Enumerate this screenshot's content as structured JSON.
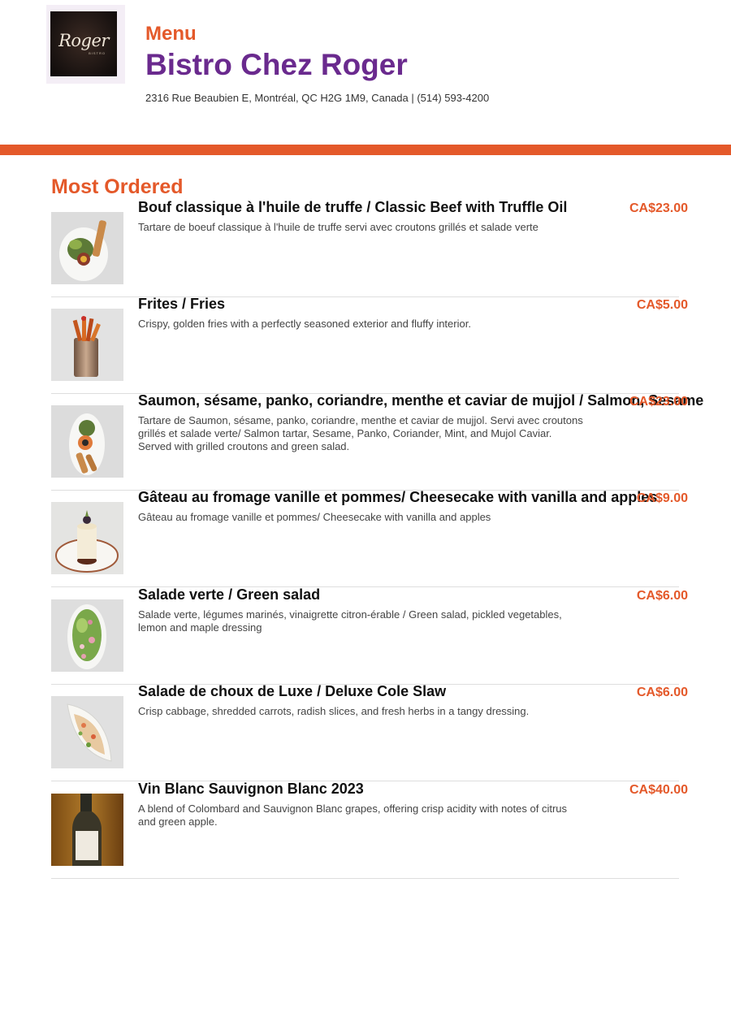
{
  "header": {
    "logo_alt_text": "Roger",
    "kicker": "Menu",
    "restaurant_name": "Bistro Chez Roger",
    "address": "2316 Rue Beaubien E, Montréal, QC H2G 1M9, Canada | (514) 593-4200"
  },
  "colors": {
    "accent": "#e4592a",
    "brand": "#6a2a8e"
  },
  "section": {
    "title": "Most Ordered",
    "items": [
      {
        "name": "Bouf classique à l'huile de truffe / Classic Beef with Truffle Oil",
        "description": "Tartare de boeuf classique à l'huile de truffe servi avec croutons grillés et salade verte",
        "price": "CA$23.00",
        "image": "beef-tartare-plate"
      },
      {
        "name": "Frites / Fries",
        "description": "Crispy, golden fries with a perfectly seasoned exterior and fluffy interior.",
        "price": "CA$5.00",
        "image": "fries-cup"
      },
      {
        "name": "Saumon, sésame, panko, coriandre, menthe et caviar de mujjol / Salmon, Sesame",
        "description": "Tartare de Saumon, sésame, panko, coriandre, menthe et caviar de mujjol. Servi avec croutons grillés et salade verte/ Salmon tartar, Sesame, Panko, Coriander, Mint, and Mujol Caviar. Served with grilled croutons and green salad.",
        "price": "CA$23.00",
        "image": "salmon-tartare-plate"
      },
      {
        "name": "Gâteau au fromage vanille et pommes/ Cheesecake with vanilla and apples",
        "description": "Gâteau au fromage vanille et pommes/ Cheesecake with vanilla and apples",
        "price": "CA$9.00",
        "image": "cheesecake-plate"
      },
      {
        "name": "Salade verte / Green salad",
        "description": "Salade verte, légumes marinés, vinaigrette citron-érable / Green salad, pickled vegetables, lemon and maple dressing",
        "price": "CA$6.00",
        "image": "green-salad-bowl"
      },
      {
        "name": "Salade de choux de Luxe / Deluxe Cole Slaw",
        "description": "Crisp cabbage, shredded carrots, radish slices, and fresh herbs in a tangy dressing.",
        "price": "CA$6.00",
        "image": "coleslaw-dish"
      },
      {
        "name": "Vin Blanc Sauvignon Blanc 2023",
        "description": "A blend of Colombard and Sauvignon Blanc grapes, offering crisp acidity with notes of citrus and green apple.",
        "price": "CA$40.00",
        "image": "wine-bottle"
      }
    ]
  }
}
